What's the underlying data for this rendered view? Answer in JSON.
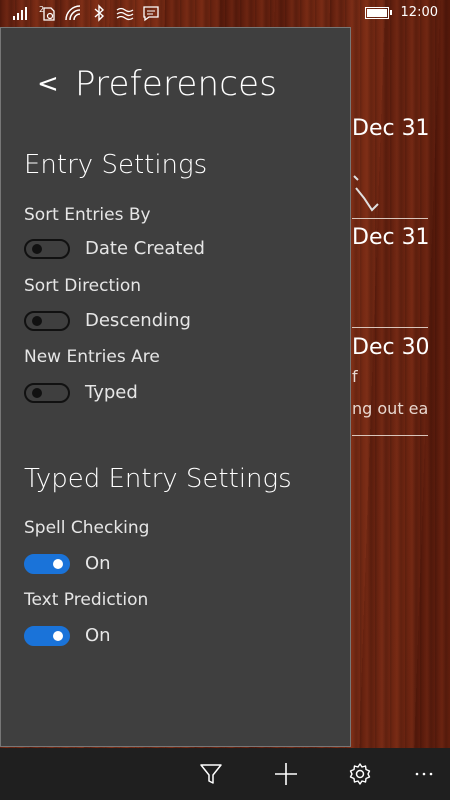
{
  "status_bar": {
    "time": "12:00",
    "icons": [
      "signal-icon",
      "sim-2-icon",
      "wifi-icon",
      "bluetooth-icon",
      "sound-waves-icon",
      "message-icon",
      "battery-icon"
    ]
  },
  "background_entries": [
    {
      "date": "Dec 31",
      "preview": ""
    },
    {
      "date": "Dec 31",
      "preview": ""
    },
    {
      "date": "Dec 30",
      "preview_top": "f",
      "preview": "ng out ea"
    }
  ],
  "preferences": {
    "back_label": "<",
    "title": "Preferences",
    "entry_settings": {
      "heading": "Entry Settings",
      "sort_by": {
        "label": "Sort Entries By",
        "state": "off",
        "value": "Date Created"
      },
      "sort_direction": {
        "label": "Sort Direction",
        "state": "off",
        "value": "Descending"
      },
      "new_entries": {
        "label": "New Entries Are",
        "state": "off",
        "value": "Typed"
      }
    },
    "typed_settings": {
      "heading": "Typed Entry Settings",
      "spell_checking": {
        "label": "Spell Checking",
        "state": "on",
        "value": "On"
      },
      "text_prediction": {
        "label": "Text Prediction",
        "state": "on",
        "value": "On"
      }
    }
  },
  "app_bar": {
    "buttons": [
      "filter-icon",
      "add-icon",
      "settings-icon",
      "more-icon"
    ]
  },
  "colors": {
    "accent": "#1a73d9",
    "panel": "#3f3f3f",
    "app_bar": "#1f1f1f"
  }
}
